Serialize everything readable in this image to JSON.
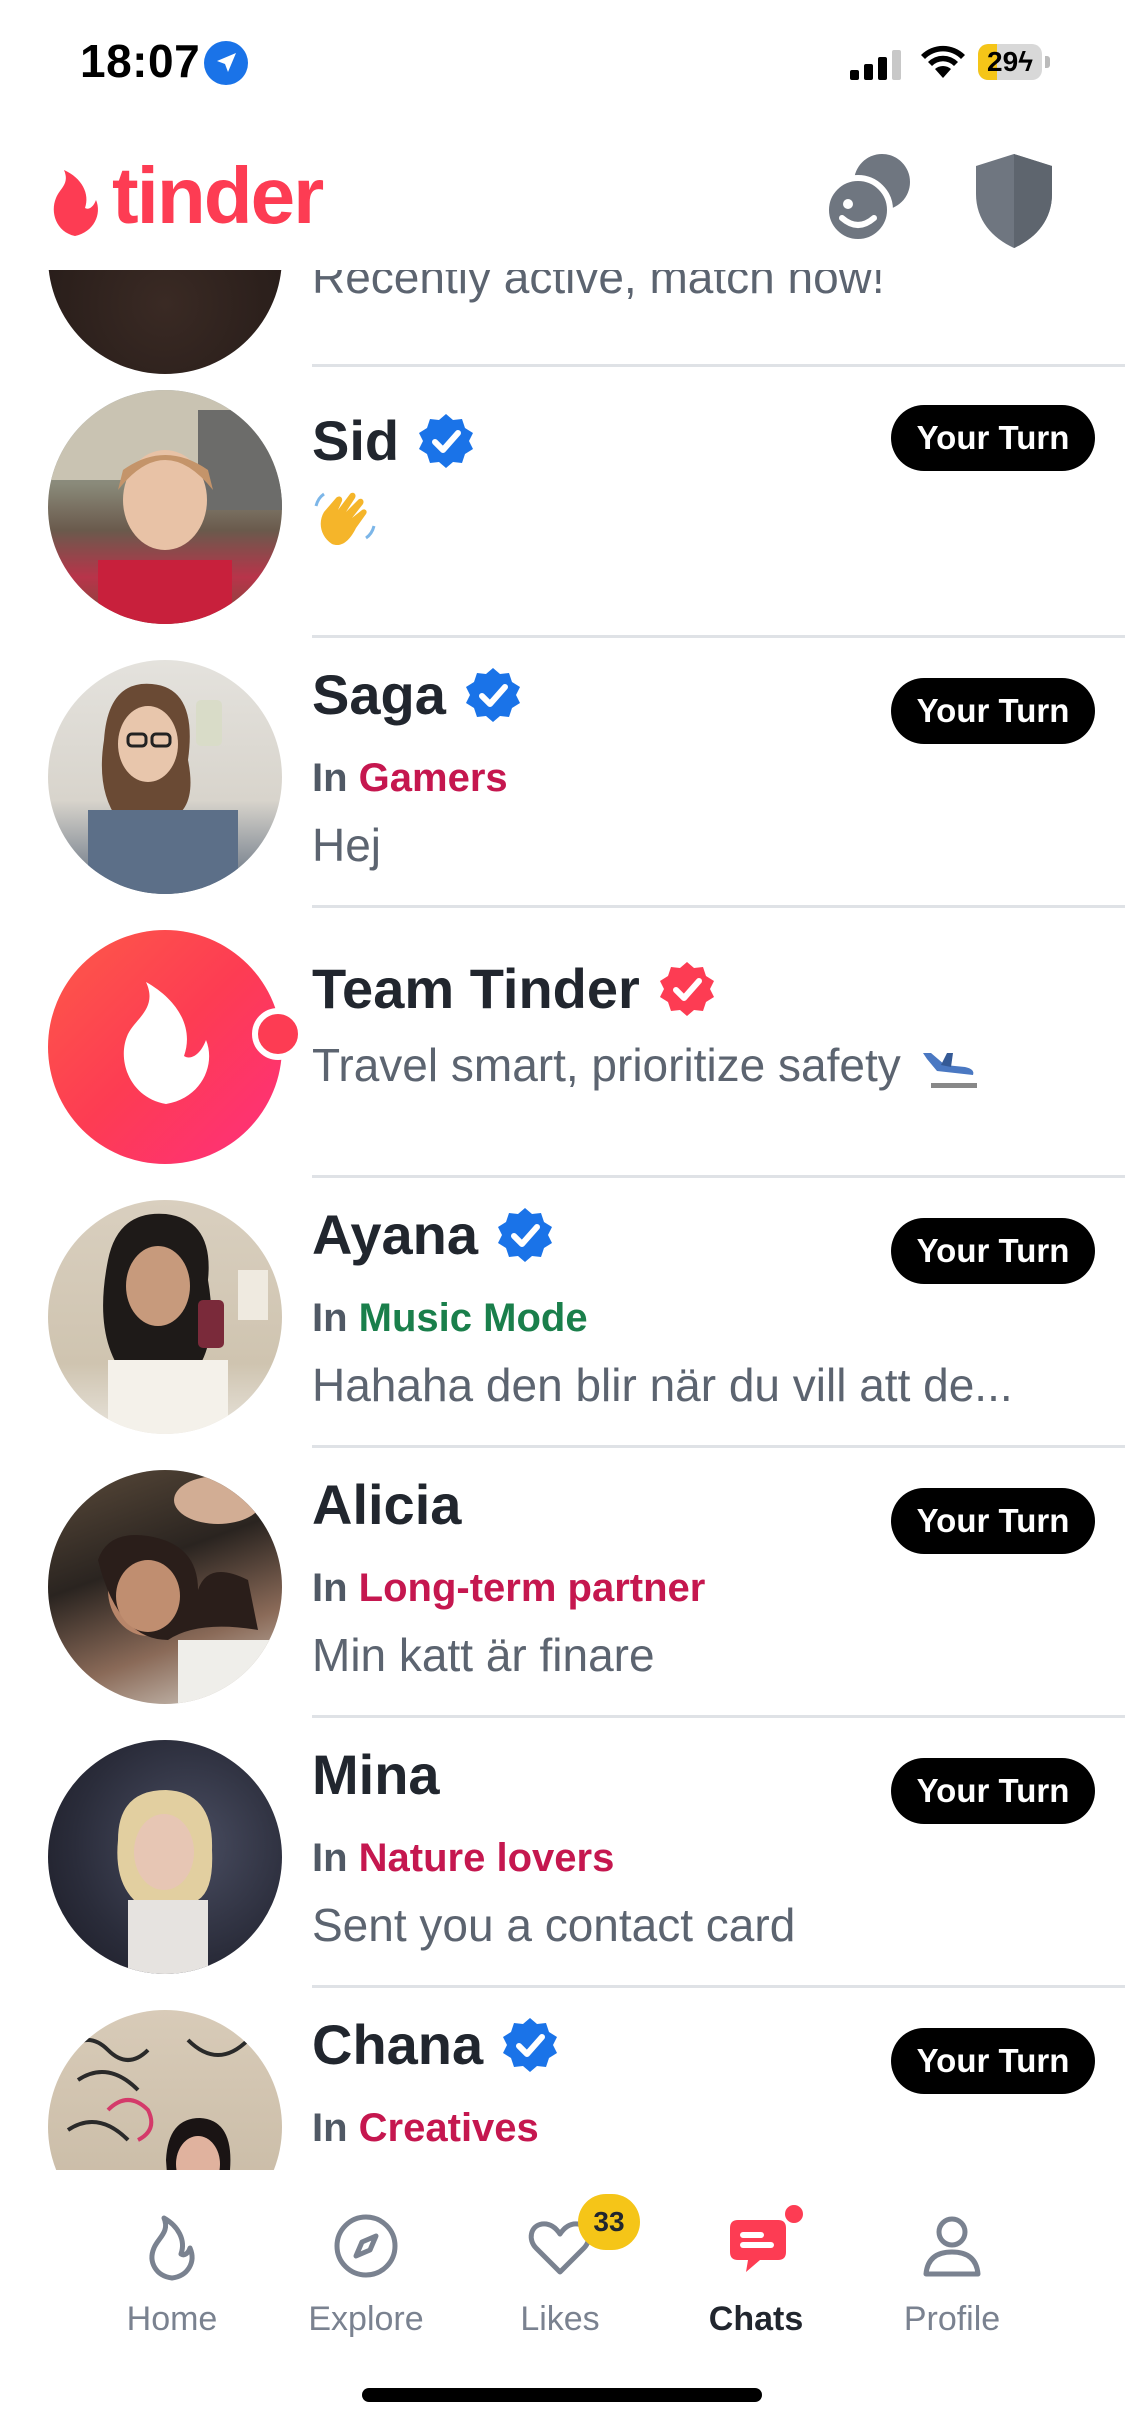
{
  "status_bar": {
    "time": "18:07",
    "battery": "29",
    "battery_level": 0.29
  },
  "header": {
    "logo_text": "tinder",
    "colors": {
      "brand": "#fd3c53",
      "icon_gray": "#6f7680"
    }
  },
  "partial_row": {
    "preview": "Recently active, match now!"
  },
  "chats": [
    {
      "name": "Sid",
      "verified": true,
      "mode_prefix": "",
      "mode": "",
      "preview": "",
      "emoji": "waving-hand",
      "badge": "Your Turn"
    },
    {
      "name": "Saga",
      "verified": true,
      "mode_prefix": "In",
      "mode": "Gamers",
      "mode_color": "#c5174f",
      "preview": "Hej",
      "badge": "Your Turn"
    },
    {
      "name": "Team Tinder",
      "verified": true,
      "verified_color": "#fd3c53",
      "mode_prefix": "",
      "mode": "",
      "preview": "Travel smart, prioritize safety",
      "badge": ""
    },
    {
      "name": "Ayana",
      "verified": true,
      "mode_prefix": "In",
      "mode": "Music Mode",
      "mode_color": "#1a7f4b",
      "preview": "Hahaha den blir när du vill att de...",
      "badge": "Your Turn"
    },
    {
      "name": "Alicia",
      "verified": false,
      "mode_prefix": "In",
      "mode": "Long-term partner",
      "mode_color": "#c5174f",
      "preview": "Min katt är finare",
      "badge": "Your Turn"
    },
    {
      "name": "Mina",
      "verified": false,
      "mode_prefix": "In",
      "mode": "Nature lovers",
      "mode_color": "#c5174f",
      "preview": "Sent you a contact card",
      "badge": "Your Turn"
    },
    {
      "name": "Chana",
      "verified": true,
      "mode_prefix": "In",
      "mode": "Creatives",
      "mode_color": "#c5174f",
      "preview": "",
      "badge": "Your Turn"
    }
  ],
  "tab_bar": {
    "tabs": [
      {
        "label": "Home",
        "icon": "flame-icon",
        "active": false
      },
      {
        "label": "Explore",
        "icon": "compass-icon",
        "active": false
      },
      {
        "label": "Likes",
        "icon": "heart-icon",
        "active": false,
        "badge": "33"
      },
      {
        "label": "Chats",
        "icon": "chat-icon",
        "active": true
      },
      {
        "label": "Profile",
        "icon": "person-icon",
        "active": false
      }
    ]
  }
}
